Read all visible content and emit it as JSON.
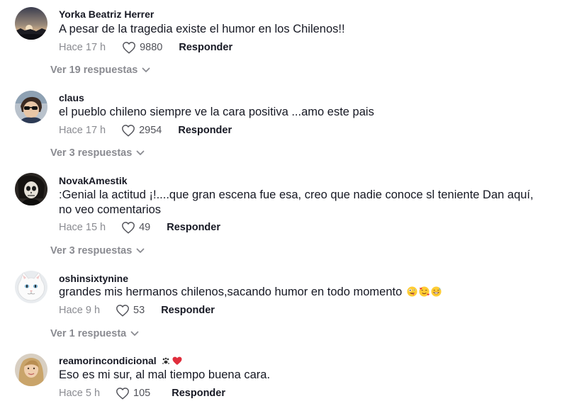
{
  "comments": [
    {
      "username": "Yorka Beatriz Herrer",
      "text": "A pesar de la tragedia existe el humor en los Chilenos!!",
      "time": "Hace 17 h",
      "likes": "9880",
      "reply_label": "Responder",
      "view_replies": "Ver 19 respuestas",
      "avatar": "sunset-landscape-avatar"
    },
    {
      "username": "claus",
      "text": "el pueblo chileno siempre ve la cara positiva ...amo este pais",
      "time": "Hace 17 h",
      "likes": "2954",
      "reply_label": "Responder",
      "view_replies": "Ver 3 respuestas",
      "avatar": "person-sunglasses-avatar"
    },
    {
      "username": "NovakAmestik",
      "text": ":Genial la actitud ¡!....que gran escena fue esa, creo que nadie conoce sl teniente Dan aquí, no veo comentarios",
      "time": "Hace 15 h",
      "likes": "49",
      "reply_label": "Responder",
      "view_replies": "Ver 3 respuestas",
      "avatar": "skull-face-avatar"
    },
    {
      "username": "oshinsixtynine",
      "text": "grandes mis hermanos chilenos,sacando humor en todo momento",
      "time": "Hace 9 h",
      "likes": "53",
      "reply_label": "Responder",
      "view_replies": "Ver 1 respuesta",
      "avatar": "white-cat-avatar",
      "emojis": [
        "zany-face-emoji",
        "smiling-face-with-hearts-emoji",
        "grinning-sweat-emoji"
      ]
    },
    {
      "username": "reamorincondicional",
      "text": "Eso es mi sur, al mal tiempo buena cara.",
      "time": "Hace 5 h",
      "likes": "105",
      "reply_label": "Responder",
      "avatar": "blonde-woman-avatar",
      "name_badges": [
        "paw-prints-emoji",
        "red-heart-emoji"
      ]
    }
  ],
  "colors": {
    "text": "#161823",
    "secondary": "#8a8b91",
    "count": "#515259",
    "heart_badge": "#e02e3c"
  }
}
